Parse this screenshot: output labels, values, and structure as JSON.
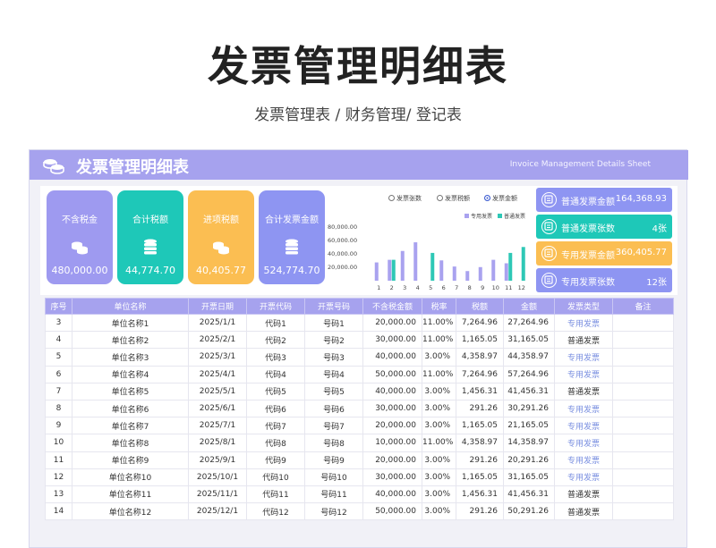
{
  "page": {
    "title": "发票管理明细表",
    "subtitle": "发票管理表 / 财务管理/ 登记表"
  },
  "sheet": {
    "title": "发票管理明细表",
    "title_en": "Invoice Management Details Sheet"
  },
  "cards": [
    {
      "label": "不含税金",
      "value": "480,000.00",
      "color": "#9e9af0"
    },
    {
      "label": "合计税额",
      "value": "44,774.70",
      "color": "#1ec8b8"
    },
    {
      "label": "进项税额",
      "value": "40,405.77",
      "color": "#fbbe52"
    },
    {
      "label": "合计发票金额",
      "value": "524,774.70",
      "color": "#8e95f2"
    }
  ],
  "chart_controls": {
    "radios": [
      {
        "label": "发票张数",
        "selected": false
      },
      {
        "label": "发票税额",
        "selected": false
      },
      {
        "label": "发票金额",
        "selected": true
      }
    ]
  },
  "chart_data": {
    "type": "bar",
    "categories": [
      "1",
      "2",
      "3",
      "4",
      "5",
      "6",
      "7",
      "8",
      "9",
      "10",
      "11",
      "12"
    ],
    "series": [
      {
        "name": "专用发票",
        "color": "#a9a2ef",
        "values": [
          27264.96,
          31165.05,
          44358.97,
          57264.96,
          0,
          30291.26,
          21165.05,
          14358.97,
          20291.26,
          31165.05,
          26000,
          0
        ]
      },
      {
        "name": "普通发票",
        "color": "#2ec8b6",
        "values": [
          0,
          31165.05,
          0,
          0,
          41456.31,
          0,
          0,
          0,
          0,
          0,
          41456.31,
          50291.26
        ]
      }
    ],
    "y_ticks": [
      "80,000.00",
      "60,000.00",
      "40,000.00",
      "20,000.00"
    ],
    "ylim": [
      0,
      80000
    ],
    "legend": "top-right"
  },
  "summary": [
    {
      "label": "普通发票金额",
      "value": "164,368.93",
      "color": "#8e95f2"
    },
    {
      "label": "普通发票张数",
      "value": "4张",
      "color": "#1ec8b8"
    },
    {
      "label": "专用发票金额",
      "value": "360,405.77",
      "color": "#fbbe52"
    },
    {
      "label": "专用发票张数",
      "value": "12张",
      "color": "#8e95f2"
    }
  ],
  "table": {
    "headers": [
      "序号",
      "单位名称",
      "开票日期",
      "开票代码",
      "开票号码",
      "不含税金额",
      "税率",
      "税额",
      "金额",
      "发票类型",
      "备注"
    ],
    "rows": [
      [
        "3",
        "单位名称1",
        "2025/1/1",
        "代码1",
        "号码1",
        "20,000.00",
        "11.00%",
        "7,264.96",
        "27,264.96",
        "专用发票",
        ""
      ],
      [
        "4",
        "单位名称2",
        "2025/2/1",
        "代码2",
        "号码2",
        "30,000.00",
        "11.00%",
        "1,165.05",
        "31,165.05",
        "普通发票",
        ""
      ],
      [
        "5",
        "单位名称3",
        "2025/3/1",
        "代码3",
        "号码3",
        "40,000.00",
        "3.00%",
        "4,358.97",
        "44,358.97",
        "专用发票",
        ""
      ],
      [
        "6",
        "单位名称4",
        "2025/4/1",
        "代码4",
        "号码4",
        "50,000.00",
        "11.00%",
        "7,264.96",
        "57,264.96",
        "专用发票",
        ""
      ],
      [
        "7",
        "单位名称5",
        "2025/5/1",
        "代码5",
        "号码5",
        "40,000.00",
        "3.00%",
        "1,456.31",
        "41,456.31",
        "普通发票",
        ""
      ],
      [
        "8",
        "单位名称6",
        "2025/6/1",
        "代码6",
        "号码6",
        "30,000.00",
        "3.00%",
        "291.26",
        "30,291.26",
        "专用发票",
        ""
      ],
      [
        "9",
        "单位名称7",
        "2025/7/1",
        "代码7",
        "号码7",
        "20,000.00",
        "3.00%",
        "1,165.05",
        "21,165.05",
        "专用发票",
        ""
      ],
      [
        "10",
        "单位名称8",
        "2025/8/1",
        "代码8",
        "号码8",
        "10,000.00",
        "11.00%",
        "4,358.97",
        "14,358.97",
        "专用发票",
        ""
      ],
      [
        "11",
        "单位名称9",
        "2025/9/1",
        "代码9",
        "号码9",
        "20,000.00",
        "3.00%",
        "291.26",
        "20,291.26",
        "专用发票",
        ""
      ],
      [
        "12",
        "单位名称10",
        "2025/10/1",
        "代码10",
        "号码10",
        "30,000.00",
        "3.00%",
        "1,165.05",
        "31,165.05",
        "专用发票",
        ""
      ],
      [
        "13",
        "单位名称11",
        "2025/11/1",
        "代码11",
        "号码11",
        "40,000.00",
        "3.00%",
        "1,456.31",
        "41,456.31",
        "普通发票",
        ""
      ],
      [
        "14",
        "单位名称12",
        "2025/12/1",
        "代码12",
        "号码12",
        "50,000.00",
        "3.00%",
        "291.26",
        "50,291.26",
        "普通发票",
        ""
      ]
    ]
  }
}
